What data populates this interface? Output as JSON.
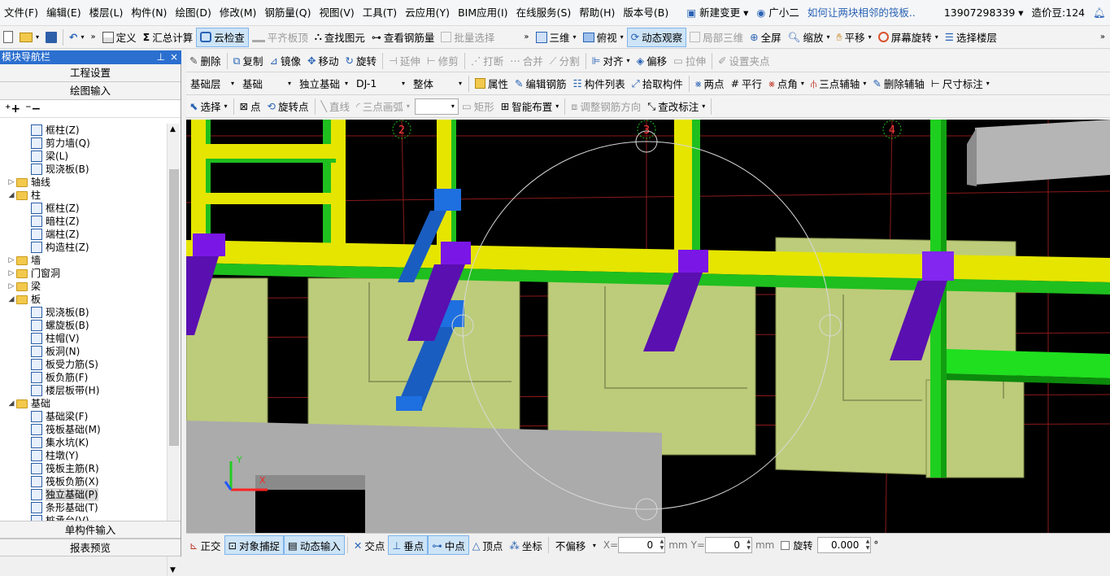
{
  "menubar": {
    "items": [
      "文件(F)",
      "编辑(E)",
      "楼层(L)",
      "构件(N)",
      "绘图(D)",
      "修改(M)",
      "钢筋量(Q)",
      "视图(V)",
      "工具(T)",
      "云应用(Y)",
      "BIM应用(I)",
      "在线服务(S)",
      "帮助(H)",
      "版本号(B)"
    ],
    "new_change": "新建变更",
    "guangxiao": "广小二",
    "question": "如何让两块相邻的筏板..",
    "phone": "13907298339",
    "beans": "造价豆:124"
  },
  "toolbar1": {
    "define": "定义",
    "sum": "汇总计算",
    "cloud_check": "云检查",
    "level_slab": "平齐板顶",
    "find": "查找图元",
    "view_rebar": "查看钢筋量",
    "batch_select": "批量选择",
    "three_d": "三维",
    "top_view": "俯视",
    "dynamic": "动态观察",
    "local3d": "局部三维",
    "fullscreen": "全屏",
    "zoom": "缩放",
    "pan": "平移",
    "rotate_screen": "屏幕旋转",
    "select_floor": "选择楼层"
  },
  "panel": {
    "title": "模块导航栏",
    "pin": "ᵖ",
    "close": "×",
    "project_settings": "工程设置",
    "drawing_input": "绘图输入",
    "single_input": "单构件输入",
    "report_preview": "报表预览"
  },
  "tree": [
    {
      "lvl": 2,
      "label": "框柱(Z)",
      "icon": "column-icon"
    },
    {
      "lvl": 2,
      "label": "剪力墙(Q)",
      "icon": "wall-icon"
    },
    {
      "lvl": 2,
      "label": "梁(L)",
      "icon": "beam-icon"
    },
    {
      "lvl": 2,
      "label": "现浇板(B)",
      "icon": "slab-icon"
    },
    {
      "lvl": 1,
      "label": "轴线",
      "icon": "folder",
      "exp": "▷"
    },
    {
      "lvl": 1,
      "label": "柱",
      "icon": "folder",
      "exp": "◢"
    },
    {
      "lvl": 2,
      "label": "框柱(Z)",
      "icon": "column-icon"
    },
    {
      "lvl": 2,
      "label": "暗柱(Z)",
      "icon": "column-icon"
    },
    {
      "lvl": 2,
      "label": "端柱(Z)",
      "icon": "column-icon"
    },
    {
      "lvl": 2,
      "label": "构造柱(Z)",
      "icon": "column-icon"
    },
    {
      "lvl": 1,
      "label": "墙",
      "icon": "folder",
      "exp": "▷"
    },
    {
      "lvl": 1,
      "label": "门窗洞",
      "icon": "folder",
      "exp": "▷"
    },
    {
      "lvl": 1,
      "label": "梁",
      "icon": "folder",
      "exp": "▷"
    },
    {
      "lvl": 1,
      "label": "板",
      "icon": "folder",
      "exp": "◢"
    },
    {
      "lvl": 2,
      "label": "现浇板(B)",
      "icon": "slab-icon"
    },
    {
      "lvl": 2,
      "label": "螺旋板(B)",
      "icon": "spiral-icon"
    },
    {
      "lvl": 2,
      "label": "柱帽(V)",
      "icon": "cap-icon"
    },
    {
      "lvl": 2,
      "label": "板洞(N)",
      "icon": "hole-icon"
    },
    {
      "lvl": 2,
      "label": "板受力筋(S)",
      "icon": "rebar-icon"
    },
    {
      "lvl": 2,
      "label": "板负筋(F)",
      "icon": "rebar-icon"
    },
    {
      "lvl": 2,
      "label": "楼层板带(H)",
      "icon": "strip-icon"
    },
    {
      "lvl": 1,
      "label": "基础",
      "icon": "folder",
      "exp": "◢"
    },
    {
      "lvl": 2,
      "label": "基础梁(F)",
      "icon": "foundation-beam-icon"
    },
    {
      "lvl": 2,
      "label": "筏板基础(M)",
      "icon": "raft-icon"
    },
    {
      "lvl": 2,
      "label": "集水坑(K)",
      "icon": "pit-icon"
    },
    {
      "lvl": 2,
      "label": "柱墩(Y)",
      "icon": "pier-icon"
    },
    {
      "lvl": 2,
      "label": "筏板主筋(R)",
      "icon": "rebar-icon"
    },
    {
      "lvl": 2,
      "label": "筏板负筋(X)",
      "icon": "rebar-icon"
    },
    {
      "lvl": 2,
      "label": "独立基础(P)",
      "icon": "isolated-footing-icon",
      "selected": true
    },
    {
      "lvl": 2,
      "label": "条形基础(T)",
      "icon": "strip-footing-icon"
    },
    {
      "lvl": 2,
      "label": "桩承台(V)",
      "icon": "pile-cap-icon"
    }
  ],
  "toolbar2": {
    "delete": "删除",
    "copy": "复制",
    "mirror": "镜像",
    "move": "移动",
    "rotate": "旋转",
    "extend": "延伸",
    "trim": "修剪",
    "break": "打断",
    "merge": "合并",
    "split": "分割",
    "align": "对齐",
    "offset": "偏移",
    "stretch": "拉伸",
    "set_grip": "设置夹点"
  },
  "toolbar3": {
    "floor": "基础层",
    "category": "基础",
    "type": "独立基础",
    "component": "DJ-1",
    "whole": "整体",
    "property": "属性",
    "edit_rebar": "编辑钢筋",
    "list": "构件列表",
    "pick": "拾取构件",
    "two_point": "两点",
    "parallel": "平行",
    "point_angle": "点角",
    "three_point_axis": "三点辅轴",
    "delete_axis": "删除辅轴",
    "dimension": "尺寸标注"
  },
  "toolbar4": {
    "select": "选择",
    "point": "点",
    "rotate_point": "旋转点",
    "line": "直线",
    "arc": "三点画弧",
    "rect": "矩形",
    "smart": "智能布置",
    "adjust_rebar": "调整钢筋方向",
    "check_label": "查改标注"
  },
  "viewport": {
    "axis_labels": [
      "2",
      "3",
      "4"
    ]
  },
  "statusbar": {
    "ortho": "正交",
    "snap": "对象捕捉",
    "dyn_input": "动态输入",
    "intersect": "交点",
    "perp": "垂点",
    "mid": "中点",
    "vertex": "顶点",
    "coord": "坐标",
    "offset_mode": "不偏移",
    "x_label": "X=",
    "x_value": "0",
    "mm1": "mm",
    "y_label": "Y=",
    "y_value": "0",
    "mm2": "mm",
    "rotate": "旋转",
    "rotate_value": "0.000",
    "deg": "°"
  }
}
